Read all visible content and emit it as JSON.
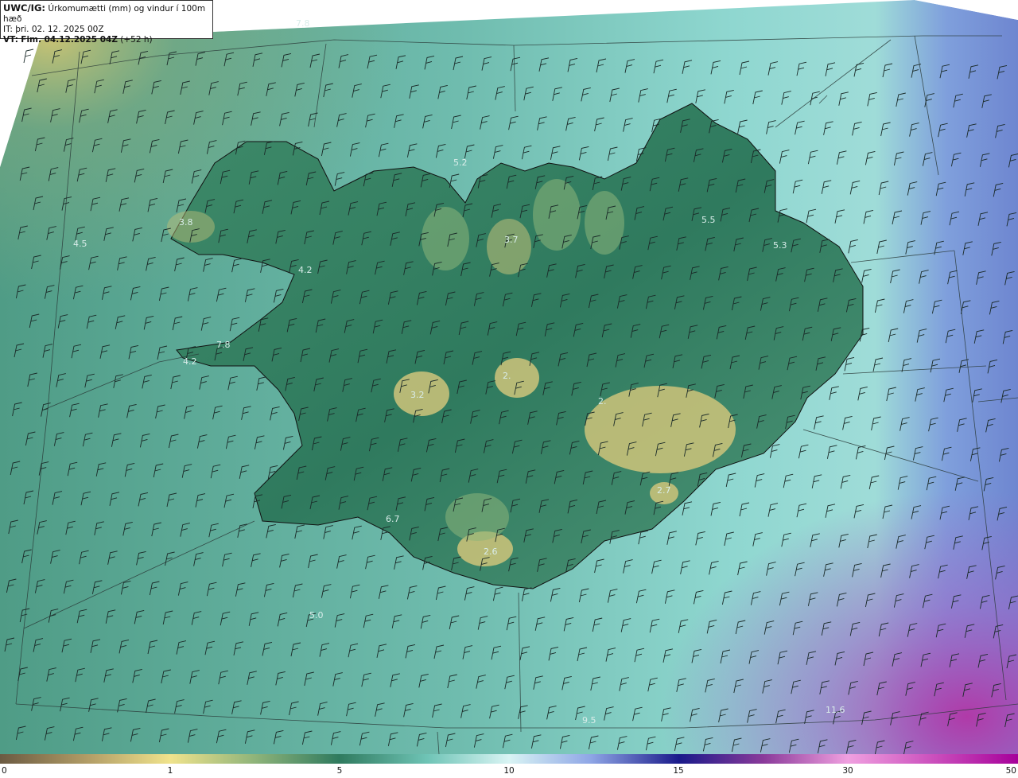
{
  "header": {
    "model": "UWC/IG:",
    "description": "Úrkomumætti (mm) og vindur í 100m hæð",
    "init_label": "IT:",
    "init_time": "þri. 02. 12. 2025 00Z",
    "valid_label": "VT:",
    "valid_time": "Fim. 04.12.2025 04Z",
    "lead": "(+52 h)"
  },
  "value_labels": [
    "7.8",
    "4.2",
    "3.8",
    "4.5",
    "3.7",
    "5.5",
    "5.3",
    "7.8",
    "4.2",
    "3.2",
    "2.",
    "2.",
    "2.7",
    "6.7",
    "2.6",
    "5.0",
    "9.5",
    "11.6",
    "5.2"
  ],
  "colorbar": {
    "ticks": [
      "0",
      "1",
      "5",
      "10",
      "15",
      "30",
      "50"
    ],
    "colors": [
      "#6b5a42",
      "#c9b26a",
      "#f0e38c",
      "#7fae7a",
      "#2f7a5e",
      "#8fd6cf",
      "#d9f4f4",
      "#6d86d6",
      "#1a1a8a",
      "#8a3a9a",
      "#e070c6",
      "#a6009a"
    ]
  },
  "colors": {
    "sea_west": "#5aa995",
    "sea_east": "#8ad3cc",
    "land_low": "#3f8a6a",
    "land_high": "#c8c276",
    "heavy_precip": "#6f8bd4"
  }
}
